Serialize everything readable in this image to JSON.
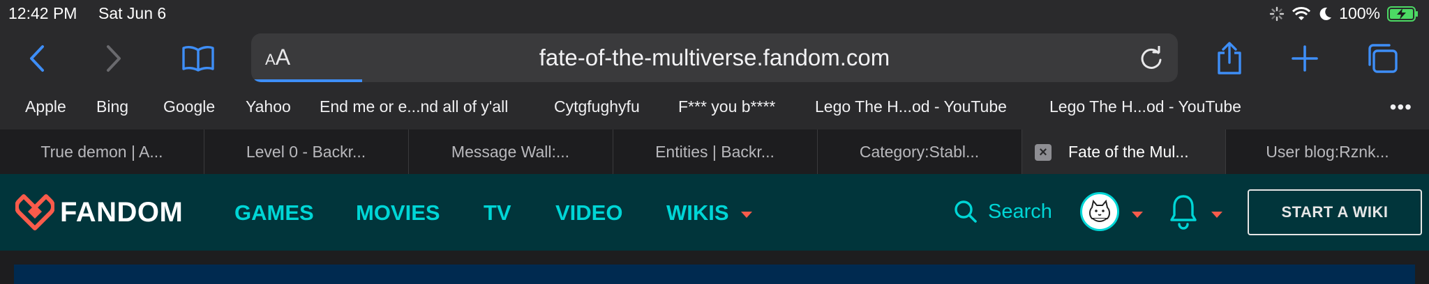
{
  "status": {
    "time": "12:42 PM",
    "date": "Sat Jun 6",
    "battery": "100%"
  },
  "toolbar": {
    "url": "fate-of-the-multiverse.fandom.com",
    "text_size_label_small": "A",
    "text_size_label_large": "A",
    "load_progress": 0.12
  },
  "bookmarks": [
    "Apple",
    "Bing",
    "Google",
    "Yahoo",
    "End me or e...nd all of y'all",
    "Cytgfughyfu",
    "F*** you b****",
    "Lego The H...od - YouTube",
    "Lego The H...od - YouTube"
  ],
  "tabs": [
    "True demon | A...",
    "Level 0 - Backr...",
    "Message Wall:...",
    "Entities | Backr...",
    "Category:Stabl...",
    "Fate of the Mul...",
    "User blog:Rznk..."
  ],
  "fandom": {
    "logo_text": "FANDOM",
    "nav": [
      "GAMES",
      "MOVIES",
      "TV",
      "VIDEO",
      "WIKIS"
    ],
    "search_label": "Search",
    "start_wiki": "START A WIKI",
    "colors": {
      "bar": "#01353b",
      "accent": "#00d6d6",
      "caret": "#fa5b4b",
      "logo": "#fa5b4b"
    }
  }
}
